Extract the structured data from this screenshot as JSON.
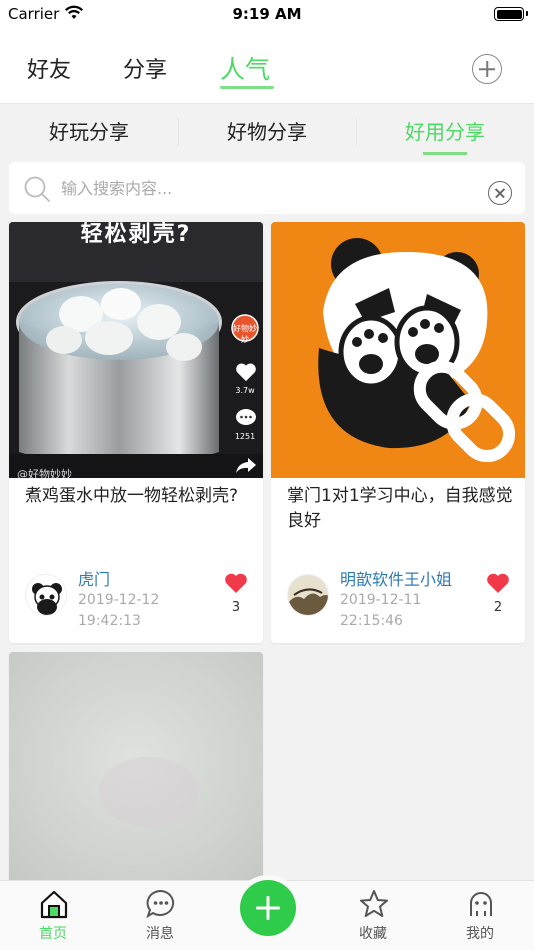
{
  "status_bar": {
    "carrier": "Carrier",
    "time": "9:19 AM"
  },
  "top_tabs": [
    {
      "label": "好友"
    },
    {
      "label": "分享"
    },
    {
      "label": "人气",
      "active": true
    }
  ],
  "sub_tabs": [
    {
      "label": "好玩分享"
    },
    {
      "label": "好物分享"
    },
    {
      "label": "好用分享",
      "active": true
    }
  ],
  "search": {
    "placeholder": "输入搜索内容...",
    "value": ""
  },
  "cards": [
    {
      "title": "煮鸡蛋水中放一物轻松剥壳?",
      "author": "虎门",
      "date": "2019-12-12",
      "time": "19:42:13",
      "likes": "3",
      "thumb_caption": "轻松剥壳?",
      "thumb_side_badge": "好物妙妙",
      "thumb_side_likes": "3.7w",
      "thumb_side_comments": "1251",
      "thumb_watermark": "@好物妙妙"
    },
    {
      "title": "掌门1对1学习中心，自我感觉良好",
      "author": "明歆软件王小姐",
      "date": "2019-12-11",
      "time": "22:15:46",
      "likes": "2"
    },
    {
      "title": ""
    }
  ],
  "tab_bar": [
    {
      "label": "首页",
      "icon": "home-icon",
      "active": true
    },
    {
      "label": "消息",
      "icon": "message-icon"
    },
    {
      "label": "",
      "icon": "add-icon"
    },
    {
      "label": "收藏",
      "icon": "star-icon"
    },
    {
      "label": "我的",
      "icon": "profile-icon"
    }
  ],
  "colors": {
    "accent": "#4cd964",
    "link": "#2e7bb4",
    "heart": "#f03a4a",
    "thumb_orange": "#f08613"
  }
}
